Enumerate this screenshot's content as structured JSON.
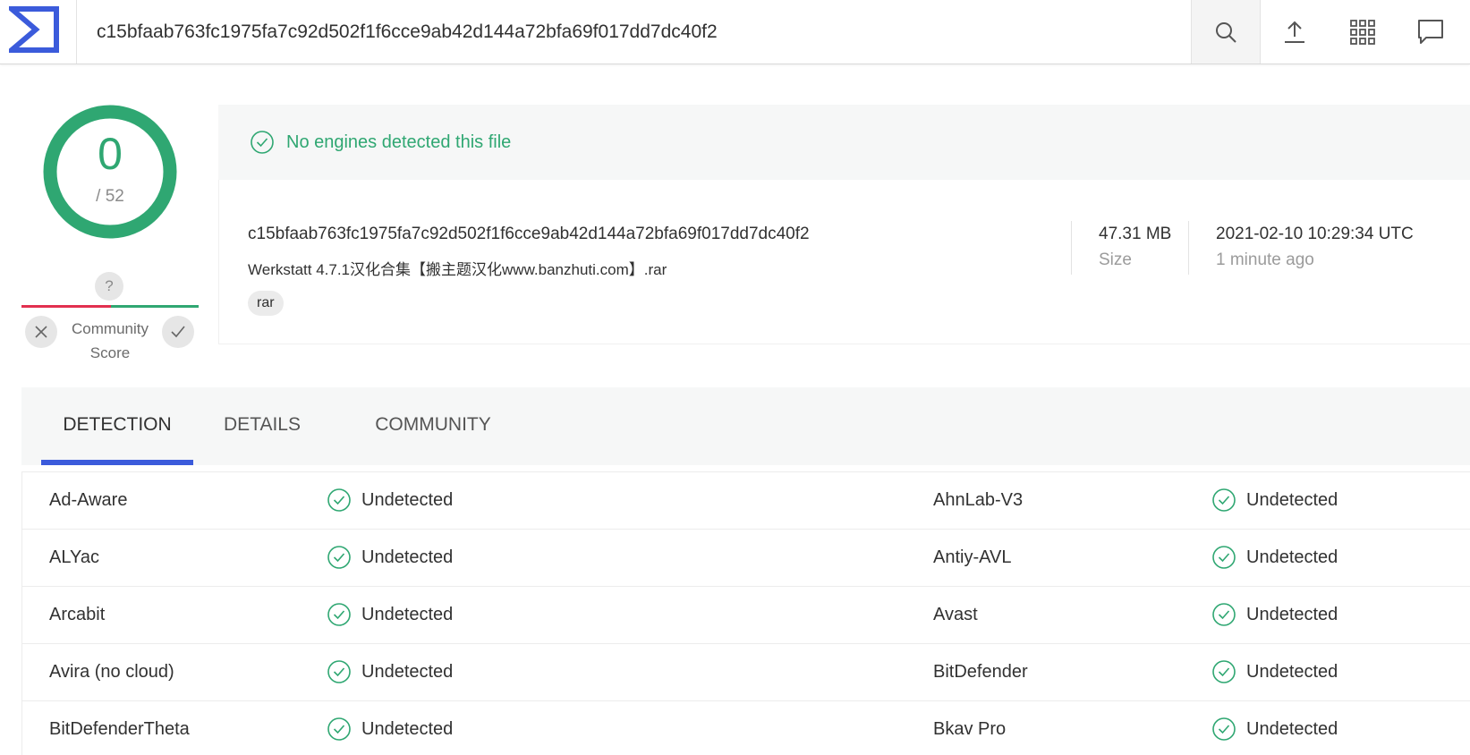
{
  "search": {
    "value": "c15bfaab763fc1975fa7c92d502f1f6cce9ab42d144a72bfa69f017dd7dc40f2"
  },
  "score": {
    "detected": "0",
    "total": "/ 52"
  },
  "community": {
    "question": "?",
    "label_line1": "Community",
    "label_line2": "Score"
  },
  "banner": {
    "text": "No engines detected this file"
  },
  "file": {
    "hash": "c15bfaab763fc1975fa7c92d502f1f6cce9ab42d144a72bfa69f017dd7dc40f2",
    "name": "Werkstatt 4.7.1汉化合集【搬主题汉化www.banzhuti.com】.rar",
    "tag": "rar",
    "size_value": "47.31 MB",
    "size_label": "Size",
    "date_value": "2021-02-10 10:29:34 UTC",
    "date_relative": "1 minute ago"
  },
  "tabs": [
    {
      "label": "DETECTION"
    },
    {
      "label": "DETAILS"
    },
    {
      "label": "COMMUNITY"
    }
  ],
  "results": [
    {
      "left_engine": "Ad-Aware",
      "left_result": "Undetected",
      "right_engine": "AhnLab-V3",
      "right_result": "Undetected"
    },
    {
      "left_engine": "ALYac",
      "left_result": "Undetected",
      "right_engine": "Antiy-AVL",
      "right_result": "Undetected"
    },
    {
      "left_engine": "Arcabit",
      "left_result": "Undetected",
      "right_engine": "Avast",
      "right_result": "Undetected"
    },
    {
      "left_engine": "Avira (no cloud)",
      "left_result": "Undetected",
      "right_engine": "BitDefender",
      "right_result": "Undetected"
    },
    {
      "left_engine": "BitDefenderTheta",
      "left_result": "Undetected",
      "right_engine": "Bkav Pro",
      "right_result": "Undetected"
    }
  ],
  "colors": {
    "clean": "#2fa772",
    "malicious": "#e2304f",
    "accent": "#3b5bdb"
  },
  "icons": {
    "logo": "virustotal-sigma-logo",
    "search": "search-icon",
    "upload": "upload-icon",
    "apps": "apps-grid-icon",
    "chat": "chat-icon",
    "check": "check-circle-icon"
  }
}
